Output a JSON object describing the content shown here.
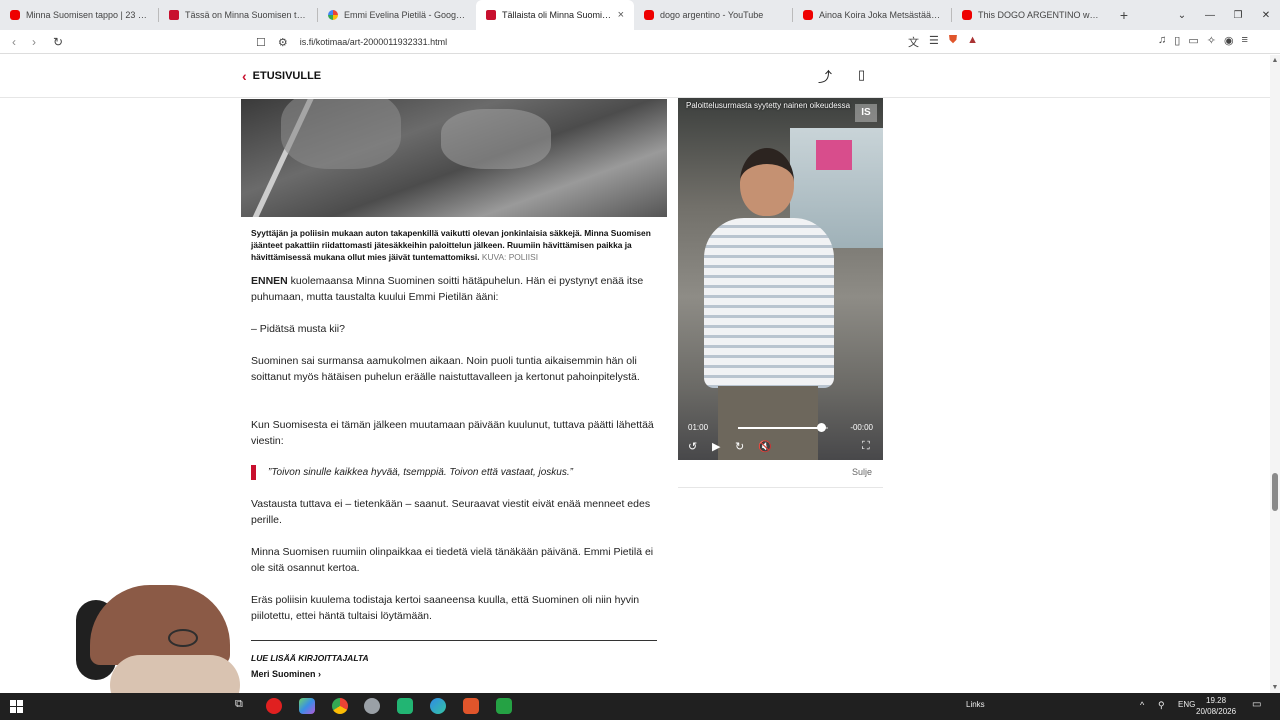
{
  "browser": {
    "tabs": [
      {
        "label": "Minna Suomisen tappo | 23 röttö -",
        "favicon": "youtube",
        "active": false
      },
      {
        "label": "Tässä on Minna Suomisen tappajat",
        "favicon": "is",
        "active": false
      },
      {
        "label": "Emmi Evelina Pietilä - Google-haku",
        "favicon": "google",
        "active": false
      },
      {
        "label": "Tällaista oli Minna Suomisen tu",
        "favicon": "is",
        "active": true
      },
      {
        "label": "dogo argentino - YouTube",
        "favicon": "youtube",
        "active": false
      },
      {
        "label": "Ainoa Koira Joka Metsästää Puma",
        "favicon": "youtube",
        "active": false
      },
      {
        "label": "This DOGO ARGENTINO was a hero |",
        "favicon": "youtube",
        "active": false
      }
    ],
    "url": "is.fi/kotimaa/art-2000011932331.html",
    "new_tab": "+",
    "close_tab": "×"
  },
  "site": {
    "back_label": "ETUSIVULLE"
  },
  "article": {
    "caption": "Syyttäjän ja poliisin mukaan auton takapenkillä vaikutti olevan jonkinlaisia säkkejä. Minna Suomisen jäänteet pakattiin riidattomasti jätesäkkeihin paloittelun jälkeen. Ruumiin hävittämisen paikka ja hävittämisessä mukana ollut mies jäivät tuntemattomiksi.",
    "caption_credit": "KUVA: POLIISI",
    "p1_lead": "ENNEN",
    "p1_rest": " kuolemaansa Minna Suominen soitti hätäpuhelun. Hän ei pystynyt enää itse puhumaan, mutta taustalta kuului Emmi Pietilän ääni:",
    "p2": "– Pidätsä musta kii?",
    "p3": "Suominen sai surmansa aamukolmen aikaan. Noin puoli tuntia aikaisemmin hän oli soittanut myös hätäisen puhelun eräälle naistuttavalleen ja kertonut pahoinpitelystä.",
    "p4": "Kun Suomisesta ei tämän jälkeen muutamaan päivään kuulunut, tuttava päätti lähettää viestin:",
    "quote": "”Toivon sinulle kaikkea hyvää, tsemppiä. Toivon että vastaat, joskus.”",
    "p5": "Vastausta tuttava ei – tietenkään – saanut. Seuraavat viestit eivät enää menneet edes perille.",
    "p6": "Minna Suomisen ruumiin olinpaikkaa ei tiedetä vielä tänäkään päivänä. Emmi Pietilä ei ole sitä osannut kertoa.",
    "p7": "Eräs poliisin kuulema todistaja kertoi saaneensa kuulla, että Suominen oli niin hyvin piilotettu, ettei häntä tultaisi löytämään.",
    "more_label": "LUE LISÄÄ KIRJOITTAJALTA",
    "author": "Meri Suominen"
  },
  "video": {
    "title": "Paloittelusurmasta syytetty nainen oikeudessa",
    "elapsed": "01:00",
    "remaining": "-00:00",
    "progress": 0.92,
    "close_label": "Sulje",
    "logo": "IS"
  },
  "taskbar": {
    "links_label": "Links",
    "lang": "ENG",
    "time": "19.28",
    "date": "20/08/2026"
  },
  "colors": {
    "accent": "#c8102e",
    "taskbar": "#202020"
  }
}
